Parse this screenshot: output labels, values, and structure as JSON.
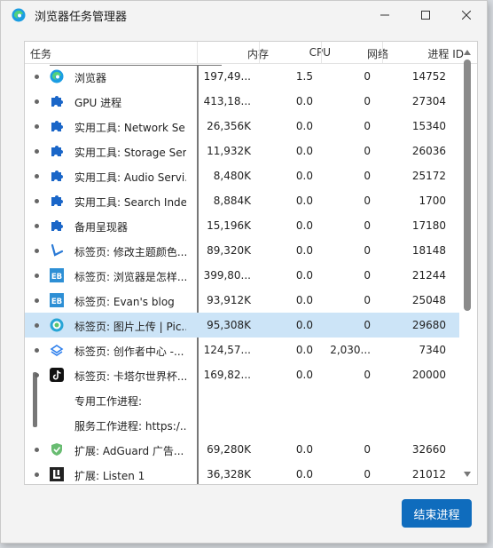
{
  "window": {
    "title": "浏览器任务管理器"
  },
  "columns": {
    "task": "任务",
    "memory": "内存",
    "cpu": "CPU",
    "network": "网络",
    "pid": "进程 ID"
  },
  "rows": [
    {
      "icon": "edge-icon",
      "task": "浏览器",
      "memory": "197,49...",
      "cpu": "1.5",
      "network": "0",
      "pid": "14752"
    },
    {
      "icon": "puzzle-icon",
      "task": "GPU 进程",
      "memory": "413,18...",
      "cpu": "0.0",
      "network": "0",
      "pid": "27304"
    },
    {
      "icon": "puzzle-icon",
      "task": "实用工具: Network Se...",
      "memory": "26,356K",
      "cpu": "0.0",
      "network": "0",
      "pid": "15340"
    },
    {
      "icon": "puzzle-icon",
      "task": "实用工具: Storage Ser...",
      "memory": "11,932K",
      "cpu": "0.0",
      "network": "0",
      "pid": "26036"
    },
    {
      "icon": "puzzle-icon",
      "task": "实用工具: Audio Servi...",
      "memory": "8,480K",
      "cpu": "0.0",
      "network": "0",
      "pid": "25172"
    },
    {
      "icon": "puzzle-icon",
      "task": "实用工具: Search Inde...",
      "memory": "8,884K",
      "cpu": "0.0",
      "network": "0",
      "pid": "1700"
    },
    {
      "icon": "puzzle-icon",
      "task": "备用呈现器",
      "memory": "15,196K",
      "cpu": "0.0",
      "network": "0",
      "pid": "17180"
    },
    {
      "icon": "checkmark-logo-icon",
      "task": "标签页: 修改主题颜色...",
      "memory": "89,320K",
      "cpu": "0.0",
      "network": "0",
      "pid": "18148"
    },
    {
      "icon": "eb-icon",
      "task": "标签页: 浏览器是怎样...",
      "memory": "399,80...",
      "cpu": "0.0",
      "network": "0",
      "pid": "21244"
    },
    {
      "icon": "eb-icon",
      "task": "标签页: Evan's blog",
      "memory": "93,912K",
      "cpu": "0.0",
      "network": "0",
      "pid": "25048"
    },
    {
      "icon": "image-upload-icon",
      "task": "标签页: 图片上传 | Pic...",
      "memory": "95,308K",
      "cpu": "0.0",
      "network": "0",
      "pid": "29680",
      "selected": true
    },
    {
      "icon": "creator-icon",
      "task": "标签页: 创作者中心 -...",
      "memory": "124,57...",
      "cpu": "0.0",
      "network": "2,030...",
      "pid": "7340"
    },
    {
      "icon": "tiktok-icon",
      "task": "标签页: 卡塔尔世界杯...",
      "memory": "169,82...",
      "cpu": "0.0",
      "network": "0",
      "pid": "20000"
    },
    {
      "icon": "",
      "task": "专用工作进程:",
      "memory": "",
      "cpu": "",
      "network": "",
      "pid": ""
    },
    {
      "icon": "",
      "task": "服务工作进程: https:/...",
      "memory": "",
      "cpu": "",
      "network": "",
      "pid": ""
    },
    {
      "icon": "adguard-icon",
      "task": "扩展: AdGuard 广告...",
      "memory": "69,280K",
      "cpu": "0.0",
      "network": "0",
      "pid": "32660"
    },
    {
      "icon": "listen-icon",
      "task": "扩展: Listen 1",
      "memory": "36,328K",
      "cpu": "0.0",
      "network": "0",
      "pid": "21012"
    }
  ],
  "footer": {
    "end_process_label": "结束进程"
  }
}
